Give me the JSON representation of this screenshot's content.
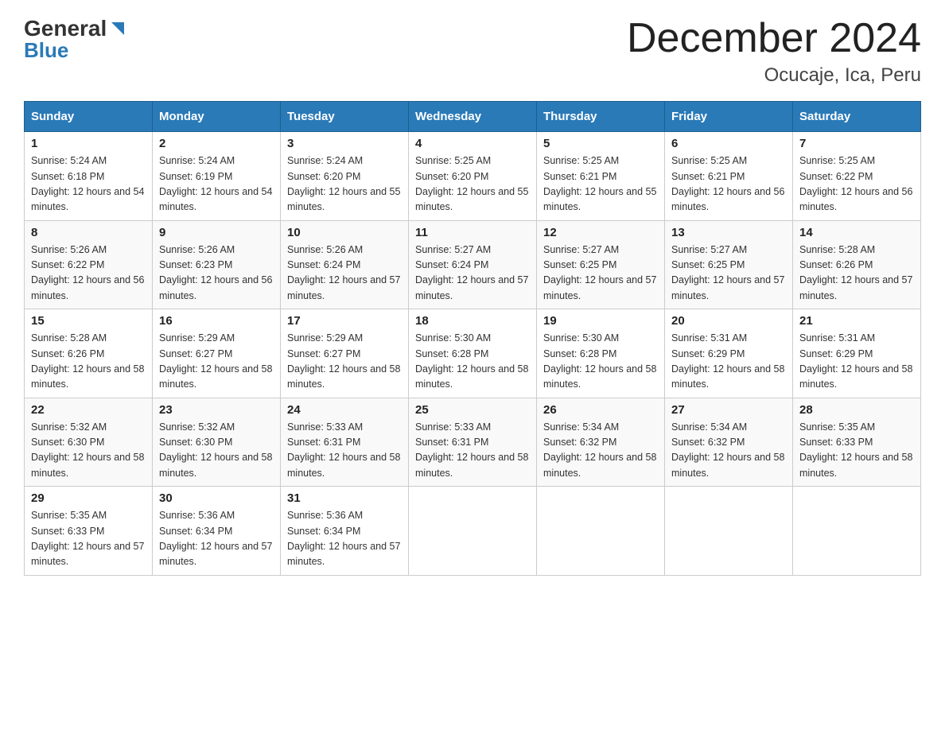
{
  "header": {
    "title": "December 2024",
    "subtitle": "Ocucaje, Ica, Peru",
    "logo_general": "General",
    "logo_blue": "Blue"
  },
  "days_of_week": [
    "Sunday",
    "Monday",
    "Tuesday",
    "Wednesday",
    "Thursday",
    "Friday",
    "Saturday"
  ],
  "weeks": [
    [
      {
        "day": "1",
        "sunrise": "5:24 AM",
        "sunset": "6:18 PM",
        "daylight": "12 hours and 54 minutes."
      },
      {
        "day": "2",
        "sunrise": "5:24 AM",
        "sunset": "6:19 PM",
        "daylight": "12 hours and 54 minutes."
      },
      {
        "day": "3",
        "sunrise": "5:24 AM",
        "sunset": "6:20 PM",
        "daylight": "12 hours and 55 minutes."
      },
      {
        "day": "4",
        "sunrise": "5:25 AM",
        "sunset": "6:20 PM",
        "daylight": "12 hours and 55 minutes."
      },
      {
        "day": "5",
        "sunrise": "5:25 AM",
        "sunset": "6:21 PM",
        "daylight": "12 hours and 55 minutes."
      },
      {
        "day": "6",
        "sunrise": "5:25 AM",
        "sunset": "6:21 PM",
        "daylight": "12 hours and 56 minutes."
      },
      {
        "day": "7",
        "sunrise": "5:25 AM",
        "sunset": "6:22 PM",
        "daylight": "12 hours and 56 minutes."
      }
    ],
    [
      {
        "day": "8",
        "sunrise": "5:26 AM",
        "sunset": "6:22 PM",
        "daylight": "12 hours and 56 minutes."
      },
      {
        "day": "9",
        "sunrise": "5:26 AM",
        "sunset": "6:23 PM",
        "daylight": "12 hours and 56 minutes."
      },
      {
        "day": "10",
        "sunrise": "5:26 AM",
        "sunset": "6:24 PM",
        "daylight": "12 hours and 57 minutes."
      },
      {
        "day": "11",
        "sunrise": "5:27 AM",
        "sunset": "6:24 PM",
        "daylight": "12 hours and 57 minutes."
      },
      {
        "day": "12",
        "sunrise": "5:27 AM",
        "sunset": "6:25 PM",
        "daylight": "12 hours and 57 minutes."
      },
      {
        "day": "13",
        "sunrise": "5:27 AM",
        "sunset": "6:25 PM",
        "daylight": "12 hours and 57 minutes."
      },
      {
        "day": "14",
        "sunrise": "5:28 AM",
        "sunset": "6:26 PM",
        "daylight": "12 hours and 57 minutes."
      }
    ],
    [
      {
        "day": "15",
        "sunrise": "5:28 AM",
        "sunset": "6:26 PM",
        "daylight": "12 hours and 58 minutes."
      },
      {
        "day": "16",
        "sunrise": "5:29 AM",
        "sunset": "6:27 PM",
        "daylight": "12 hours and 58 minutes."
      },
      {
        "day": "17",
        "sunrise": "5:29 AM",
        "sunset": "6:27 PM",
        "daylight": "12 hours and 58 minutes."
      },
      {
        "day": "18",
        "sunrise": "5:30 AM",
        "sunset": "6:28 PM",
        "daylight": "12 hours and 58 minutes."
      },
      {
        "day": "19",
        "sunrise": "5:30 AM",
        "sunset": "6:28 PM",
        "daylight": "12 hours and 58 minutes."
      },
      {
        "day": "20",
        "sunrise": "5:31 AM",
        "sunset": "6:29 PM",
        "daylight": "12 hours and 58 minutes."
      },
      {
        "day": "21",
        "sunrise": "5:31 AM",
        "sunset": "6:29 PM",
        "daylight": "12 hours and 58 minutes."
      }
    ],
    [
      {
        "day": "22",
        "sunrise": "5:32 AM",
        "sunset": "6:30 PM",
        "daylight": "12 hours and 58 minutes."
      },
      {
        "day": "23",
        "sunrise": "5:32 AM",
        "sunset": "6:30 PM",
        "daylight": "12 hours and 58 minutes."
      },
      {
        "day": "24",
        "sunrise": "5:33 AM",
        "sunset": "6:31 PM",
        "daylight": "12 hours and 58 minutes."
      },
      {
        "day": "25",
        "sunrise": "5:33 AM",
        "sunset": "6:31 PM",
        "daylight": "12 hours and 58 minutes."
      },
      {
        "day": "26",
        "sunrise": "5:34 AM",
        "sunset": "6:32 PM",
        "daylight": "12 hours and 58 minutes."
      },
      {
        "day": "27",
        "sunrise": "5:34 AM",
        "sunset": "6:32 PM",
        "daylight": "12 hours and 58 minutes."
      },
      {
        "day": "28",
        "sunrise": "5:35 AM",
        "sunset": "6:33 PM",
        "daylight": "12 hours and 58 minutes."
      }
    ],
    [
      {
        "day": "29",
        "sunrise": "5:35 AM",
        "sunset": "6:33 PM",
        "daylight": "12 hours and 57 minutes."
      },
      {
        "day": "30",
        "sunrise": "5:36 AM",
        "sunset": "6:34 PM",
        "daylight": "12 hours and 57 minutes."
      },
      {
        "day": "31",
        "sunrise": "5:36 AM",
        "sunset": "6:34 PM",
        "daylight": "12 hours and 57 minutes."
      },
      null,
      null,
      null,
      null
    ]
  ]
}
